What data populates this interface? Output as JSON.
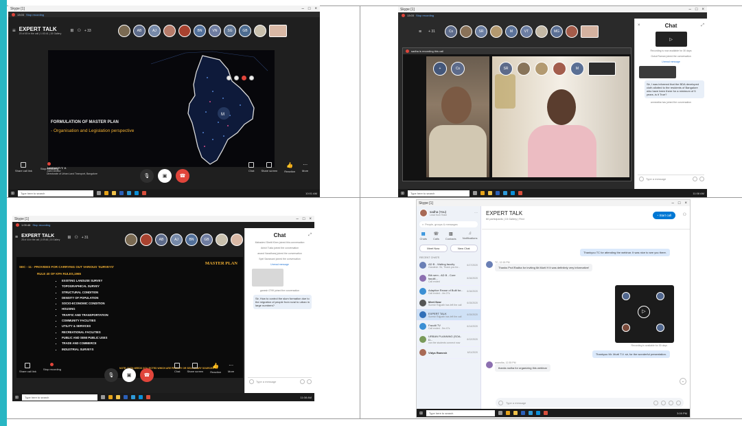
{
  "colors": {
    "accent": "#29b6c3",
    "skype_blue": "#0078d4",
    "hangup": "#e0453b",
    "slide_gold": "#f2b134"
  },
  "common": {
    "window_title": "Skype [1]",
    "taskbar_search": "Type here to search",
    "taskbar_search_alt": "Type here to search",
    "chat_title": "Chat",
    "type_message": "Type a message"
  },
  "tl": {
    "rec_time": "13:03",
    "rec_label": "Stop recording",
    "call_title": "EXPERT TALK",
    "call_meta": "20 of 45 in the call | 1:03:41 | 15 Gallery",
    "more_count": "+ 33",
    "slide_title": "FORMULATION OF MASTER PLAN",
    "slide_sub": "- Organisation and Legislation perspective",
    "speaker_name": "JANSAKTI T. V.",
    "speaker_role": "Joint Director",
    "speaker_org": "Directorate of Urban Land Transport, Bangalore",
    "share_label": "Share call link",
    "stoprec_label": "Stop recording",
    "chat_label": "Chat",
    "share_screen_label": "Share screen",
    "react_label": "Reaction",
    "more_label": "More",
    "clock": "10:01 AM"
  },
  "tr": {
    "rec_time": "13:03",
    "rec_label": "Stop recording",
    "more_count": "+ 31",
    "banner": "sadha is recording this call",
    "chat_sys1": "Recording is now available for 30 days",
    "chat_sys2": "Gokul Raman joined the conversation",
    "unread": "Unread message",
    "chat_q": "Sir, I was informed that the BDA developed cloth allotted to the residents of Bangalore who have been there for a minimum of 5 years..is it True?",
    "chat_sys3": "anmeatha has joined the conversation",
    "clock": "11:08 AM"
  },
  "bl": {
    "rec_time": "1:09:48",
    "rec_label": "Stop recording",
    "call_title": "EXPERT TALK",
    "call_meta": "28 of 44 in the call | 1:09:48 | 15 Gallery",
    "more_count": "+ 31",
    "master_plan": "MASTER PLAN",
    "sec_line": "SEC - 11 - PROVIDES FOR CARRYING OUT VARIOUS 'SURVEYS'",
    "rule_line": "RULE 40 OF KPA RULES,1965",
    "surveys": [
      "EXISTING LANDUSE SURVEY",
      "TOPOGRAPHICAL SURVEY",
      "STRUCTURAL CONDITION",
      "DENSITY OF POPULATION",
      "SOCIO-ECONOMIC CONDITION",
      "HOUSING",
      "TRAFFIC AND TRANSPORTATION",
      "COMMUNITY FACILITIES",
      "UTILITY & SERVICES",
      "RECREATIONAL FACILITIES",
      "PUBLIC AND SEMI PUBLIC USES",
      "TRADE AND COMMERCE",
      "INDUSTRIAL SURVEYS"
    ],
    "note": "NOTE: DATA NEEDS COLLECTED WHICH ARE PRIMARY OR SECONDARY SOURCES",
    "chat_sys": [
      "Mahadevi Shetti Khen joined this conversation",
      "Anish Tukla joined the conversation",
      "anand Varadharaj joined the conversation",
      "Spel Sarasvani joined the conversation"
    ],
    "unread": "Unread message",
    "chat_sys2": "ganesh 0799 joined the conversation",
    "chat_q": "Sir, How to control the slum formation due to the migration of people from rural to urban in large numbers?",
    "clock": "11:08 AM"
  },
  "br": {
    "user_name": "sadha (You)",
    "user_sub": "Lead from Team",
    "search_placeholder": "People, groups & messages",
    "nav": [
      "Chats",
      "Calls",
      "Contacts",
      "Notifications"
    ],
    "meet_now": "Meet Now",
    "new_chat": "New Chat",
    "recent_label": "RECENT CHATS",
    "recent": [
      {
        "name": "AD B - Visiting faculty",
        "sub": "Gandesh: Sir, Thank you for...",
        "date": "6/17/2020"
      },
      {
        "name": "Bth sem - AD B - Core faculti...",
        "sub": "Call ended",
        "date": "6/16/2020"
      },
      {
        "name": "Adaptive Reuse of Built for...",
        "sub": "Call ended - 4m 27s",
        "date": "6/16/2020"
      },
      {
        "name": "Meet Now",
        "sub": "Suresh Rajpath has left the call",
        "date": "6/15/2020"
      },
      {
        "name": "EXPERT TALK",
        "sub": "Suresh Rajpath has left the call",
        "date": "6/15/2020"
      },
      {
        "name": "Faculti TV",
        "sub": "Call ended - 5m 47s",
        "date": "6/14/2020"
      },
      {
        "name": "URBAN PLANNING (SOA-D...",
        "sub": "can the students connect now",
        "date": "6/12/2020"
      },
      {
        "name": "Vidya Ramesh",
        "sub": "",
        "date": "6/11/2020"
      }
    ],
    "chat_title": "EXPERT TALK",
    "chat_meta": "60 participants | 15 Gallery | Find",
    "start_call": "Start call",
    "msg1": "Thankyou TC for attending the webinar. It was nice to see you there.",
    "msg2_from": "TC, 12:15 PM",
    "msg2": "Thanks Prof.Radha for inviting Mr.Murti H it was definitely very informative!",
    "rec_note": "Recording is available for 30 days",
    "msg3": "Thankyou Mr. Murti T.V. sir, for the wonderful presentation.",
    "msg4_from": "anandha, 12:35 PM",
    "msg4": "thanks radha for organizing this webinar",
    "clock": "3:09 PM"
  }
}
